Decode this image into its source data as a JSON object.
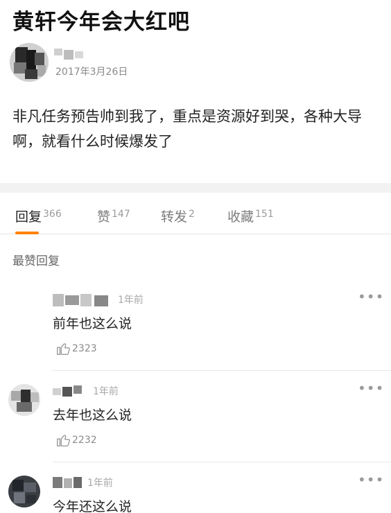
{
  "post": {
    "title": "黄轩今年会大红吧",
    "date": "2017年3月26日",
    "body": "非凡任务预告帅到我了，重点是资源好到哭，各种大导啊，就看什么时候爆发了"
  },
  "tabs": [
    {
      "label": "回复",
      "count": "366"
    },
    {
      "label": "赞",
      "count": "147"
    },
    {
      "label": "转发",
      "count": "2"
    },
    {
      "label": "收藏",
      "count": "151"
    }
  ],
  "section_label": "最赞回复",
  "replies": [
    {
      "time": "1年前",
      "text": "前年也这么说",
      "likes": "2323"
    },
    {
      "time": "1年前",
      "text": "去年也这么说",
      "likes": "2232"
    },
    {
      "time": "1年前",
      "text": "今年还这么说"
    }
  ],
  "icons": {
    "more": "more-horizontal-icon",
    "like": "thumbs-up-icon"
  },
  "colors": {
    "accent": "#ff8200",
    "text": "#222222",
    "muted": "#8a8a8a"
  }
}
